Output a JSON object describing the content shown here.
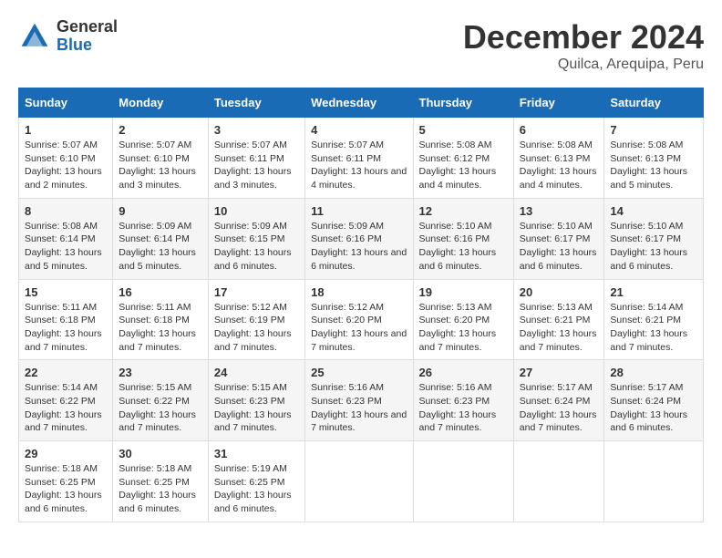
{
  "logo": {
    "general": "General",
    "blue": "Blue"
  },
  "title": "December 2024",
  "location": "Quilca, Arequipa, Peru",
  "days_of_week": [
    "Sunday",
    "Monday",
    "Tuesday",
    "Wednesday",
    "Thursday",
    "Friday",
    "Saturday"
  ],
  "weeks": [
    [
      {
        "day": 1,
        "sunrise": "5:07 AM",
        "sunset": "6:10 PM",
        "daylight": "13 hours and 2 minutes."
      },
      {
        "day": 2,
        "sunrise": "5:07 AM",
        "sunset": "6:10 PM",
        "daylight": "13 hours and 3 minutes."
      },
      {
        "day": 3,
        "sunrise": "5:07 AM",
        "sunset": "6:11 PM",
        "daylight": "13 hours and 3 minutes."
      },
      {
        "day": 4,
        "sunrise": "5:07 AM",
        "sunset": "6:11 PM",
        "daylight": "13 hours and 4 minutes."
      },
      {
        "day": 5,
        "sunrise": "5:08 AM",
        "sunset": "6:12 PM",
        "daylight": "13 hours and 4 minutes."
      },
      {
        "day": 6,
        "sunrise": "5:08 AM",
        "sunset": "6:13 PM",
        "daylight": "13 hours and 4 minutes."
      },
      {
        "day": 7,
        "sunrise": "5:08 AM",
        "sunset": "6:13 PM",
        "daylight": "13 hours and 5 minutes."
      }
    ],
    [
      {
        "day": 8,
        "sunrise": "5:08 AM",
        "sunset": "6:14 PM",
        "daylight": "13 hours and 5 minutes."
      },
      {
        "day": 9,
        "sunrise": "5:09 AM",
        "sunset": "6:14 PM",
        "daylight": "13 hours and 5 minutes."
      },
      {
        "day": 10,
        "sunrise": "5:09 AM",
        "sunset": "6:15 PM",
        "daylight": "13 hours and 6 minutes."
      },
      {
        "day": 11,
        "sunrise": "5:09 AM",
        "sunset": "6:16 PM",
        "daylight": "13 hours and 6 minutes."
      },
      {
        "day": 12,
        "sunrise": "5:10 AM",
        "sunset": "6:16 PM",
        "daylight": "13 hours and 6 minutes."
      },
      {
        "day": 13,
        "sunrise": "5:10 AM",
        "sunset": "6:17 PM",
        "daylight": "13 hours and 6 minutes."
      },
      {
        "day": 14,
        "sunrise": "5:10 AM",
        "sunset": "6:17 PM",
        "daylight": "13 hours and 6 minutes."
      }
    ],
    [
      {
        "day": 15,
        "sunrise": "5:11 AM",
        "sunset": "6:18 PM",
        "daylight": "13 hours and 7 minutes."
      },
      {
        "day": 16,
        "sunrise": "5:11 AM",
        "sunset": "6:18 PM",
        "daylight": "13 hours and 7 minutes."
      },
      {
        "day": 17,
        "sunrise": "5:12 AM",
        "sunset": "6:19 PM",
        "daylight": "13 hours and 7 minutes."
      },
      {
        "day": 18,
        "sunrise": "5:12 AM",
        "sunset": "6:20 PM",
        "daylight": "13 hours and 7 minutes."
      },
      {
        "day": 19,
        "sunrise": "5:13 AM",
        "sunset": "6:20 PM",
        "daylight": "13 hours and 7 minutes."
      },
      {
        "day": 20,
        "sunrise": "5:13 AM",
        "sunset": "6:21 PM",
        "daylight": "13 hours and 7 minutes."
      },
      {
        "day": 21,
        "sunrise": "5:14 AM",
        "sunset": "6:21 PM",
        "daylight": "13 hours and 7 minutes."
      }
    ],
    [
      {
        "day": 22,
        "sunrise": "5:14 AM",
        "sunset": "6:22 PM",
        "daylight": "13 hours and 7 minutes."
      },
      {
        "day": 23,
        "sunrise": "5:15 AM",
        "sunset": "6:22 PM",
        "daylight": "13 hours and 7 minutes."
      },
      {
        "day": 24,
        "sunrise": "5:15 AM",
        "sunset": "6:23 PM",
        "daylight": "13 hours and 7 minutes."
      },
      {
        "day": 25,
        "sunrise": "5:16 AM",
        "sunset": "6:23 PM",
        "daylight": "13 hours and 7 minutes."
      },
      {
        "day": 26,
        "sunrise": "5:16 AM",
        "sunset": "6:23 PM",
        "daylight": "13 hours and 7 minutes."
      },
      {
        "day": 27,
        "sunrise": "5:17 AM",
        "sunset": "6:24 PM",
        "daylight": "13 hours and 7 minutes."
      },
      {
        "day": 28,
        "sunrise": "5:17 AM",
        "sunset": "6:24 PM",
        "daylight": "13 hours and 6 minutes."
      }
    ],
    [
      {
        "day": 29,
        "sunrise": "5:18 AM",
        "sunset": "6:25 PM",
        "daylight": "13 hours and 6 minutes."
      },
      {
        "day": 30,
        "sunrise": "5:18 AM",
        "sunset": "6:25 PM",
        "daylight": "13 hours and 6 minutes."
      },
      {
        "day": 31,
        "sunrise": "5:19 AM",
        "sunset": "6:25 PM",
        "daylight": "13 hours and 6 minutes."
      },
      null,
      null,
      null,
      null
    ]
  ]
}
